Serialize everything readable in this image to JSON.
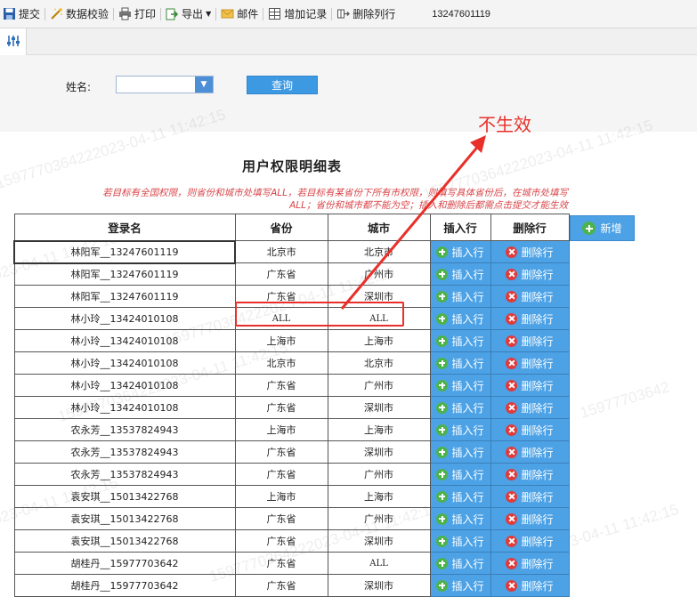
{
  "toolbar": {
    "submit": "提交",
    "validate": "数据校验",
    "print": "打印",
    "export": "导出",
    "mail": "邮件",
    "add_record": "增加记录",
    "delete_column": "删除列行",
    "phone": "13247601119"
  },
  "query": {
    "name_label": "姓名:",
    "name_value": "",
    "search_button": "查询"
  },
  "annotation": {
    "text": "不生效",
    "color": "#e8302a"
  },
  "report": {
    "title": "用户权限明细表",
    "note_line1": "若目标有全国权限，则省份和城市处填写ALL，若目标有某省份下所有市权限，则填写具体省份后，在城市处填写",
    "note_line2": "ALL；省份和城市都不能为空；插入和删除后都需点击提交才能生效",
    "add_button": "新增",
    "headers": [
      "登录名",
      "省份",
      "城市",
      "插入行",
      "删除行"
    ],
    "insert_label": "插入行",
    "delete_label": "删除行",
    "rows": [
      {
        "login": "林阳军__13247601119",
        "province": "北京市",
        "city": "北京市"
      },
      {
        "login": "林阳军__13247601119",
        "province": "广东省",
        "city": "广州市"
      },
      {
        "login": "林阳军__13247601119",
        "province": "广东省",
        "city": "深圳市"
      },
      {
        "login": "林小玲__13424010108",
        "province": "ALL",
        "city": "ALL"
      },
      {
        "login": "林小玲__13424010108",
        "province": "上海市",
        "city": "上海市"
      },
      {
        "login": "林小玲__13424010108",
        "province": "北京市",
        "city": "北京市"
      },
      {
        "login": "林小玲__13424010108",
        "province": "广东省",
        "city": "广州市"
      },
      {
        "login": "林小玲__13424010108",
        "province": "广东省",
        "city": "深圳市"
      },
      {
        "login": "农永芳__13537824943",
        "province": "上海市",
        "city": "上海市"
      },
      {
        "login": "农永芳__13537824943",
        "province": "广东省",
        "city": "深圳市"
      },
      {
        "login": "农永芳__13537824943",
        "province": "广东省",
        "city": "广州市"
      },
      {
        "login": "袁安琪__15013422768",
        "province": "上海市",
        "city": "上海市"
      },
      {
        "login": "袁安琪__15013422768",
        "province": "广东省",
        "city": "广州市"
      },
      {
        "login": "袁安琪__15013422768",
        "province": "广东省",
        "city": "深圳市"
      },
      {
        "login": "胡桂丹__15977703642",
        "province": "广东省",
        "city": "ALL"
      },
      {
        "login": "胡桂丹__15977703642",
        "province": "广东省",
        "city": "深圳市"
      }
    ]
  },
  "watermarks": [
    "1597770364222023-04-11 11:42:15",
    "15977703642",
    "2023-04-11 11:42:15"
  ],
  "colors": {
    "accent": "#4da2e6",
    "insert_icon": "#4cb34c",
    "delete_icon": "#e03a3a",
    "note": "#d8464a"
  }
}
